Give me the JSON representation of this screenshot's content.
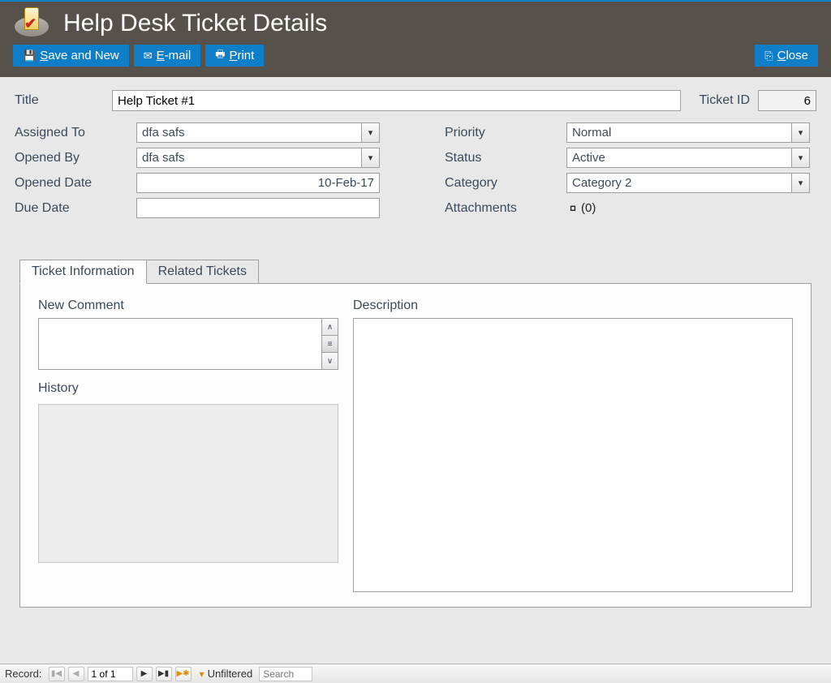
{
  "header": {
    "title": "Help Desk Ticket Details"
  },
  "toolbar": {
    "save_new": "Save and New",
    "email": "E-mail",
    "print": "Print",
    "close": "Close"
  },
  "form": {
    "title_label": "Title",
    "title_value": "Help Ticket #1",
    "ticket_id_label": "Ticket ID",
    "ticket_id_value": "6",
    "assigned_label": "Assigned To",
    "assigned_value": "dfa safs",
    "opened_by_label": "Opened By",
    "opened_by_value": "dfa safs",
    "opened_date_label": "Opened Date",
    "opened_date_value": "10-Feb-17",
    "due_date_label": "Due Date",
    "due_date_value": "",
    "priority_label": "Priority",
    "priority_value": "Normal",
    "status_label": "Status",
    "status_value": "Active",
    "category_label": "Category",
    "category_value": "Category 2",
    "attachments_label": "Attachments",
    "attachments_count": "(0)"
  },
  "tabs": {
    "info": "Ticket Information",
    "related": "Related Tickets",
    "new_comment_label": "New Comment",
    "history_label": "History",
    "description_label": "Description"
  },
  "nav": {
    "record_label": "Record:",
    "position": "1 of 1",
    "filter_label": "Unfiltered",
    "search_placeholder": "Search"
  }
}
